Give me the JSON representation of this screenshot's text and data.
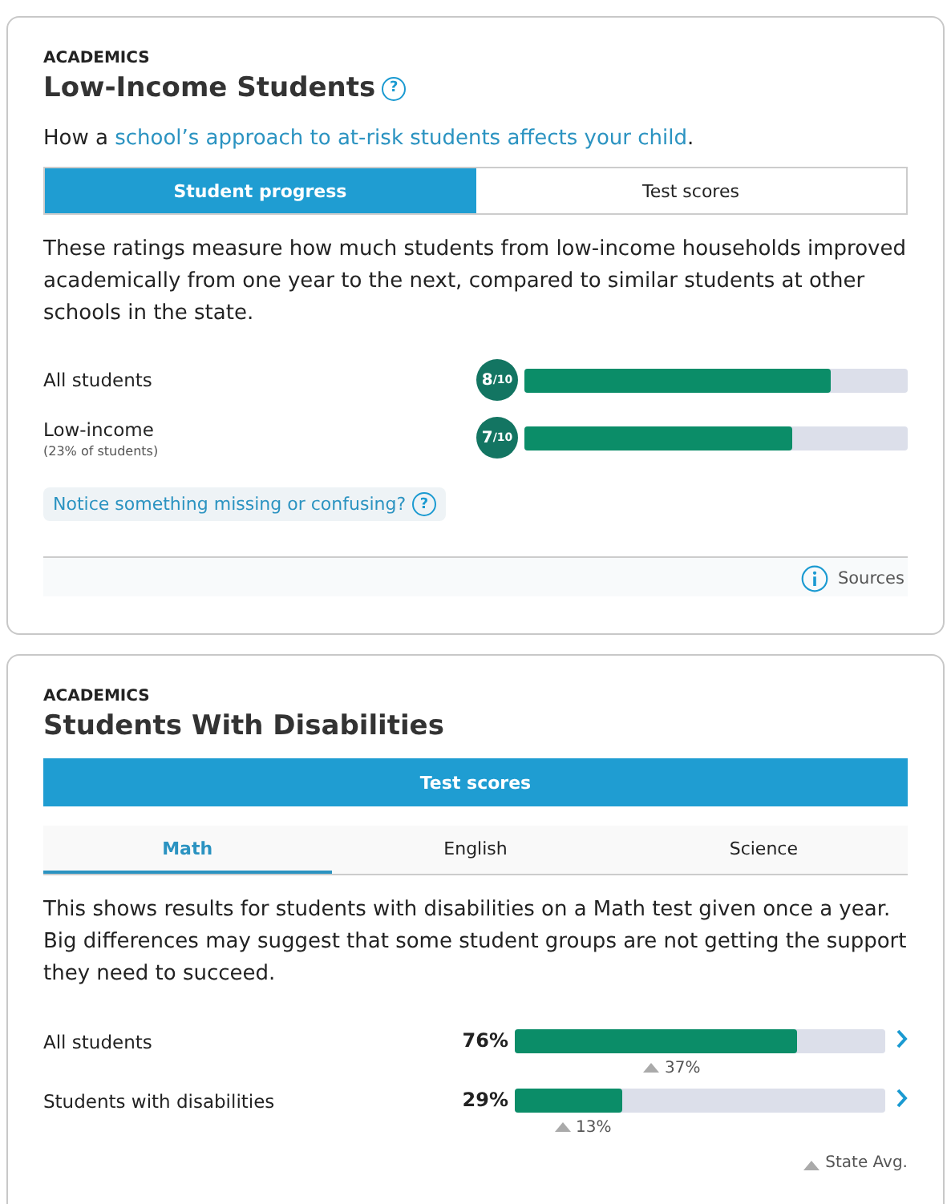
{
  "low_income": {
    "eyebrow": "ACADEMICS",
    "title": "Low-Income Students",
    "help_icon": "?",
    "intro": "How a ",
    "intro_link": "school’s approach to at-risk students affects your child",
    "intro_end": ".",
    "tabs": [
      {
        "label": "Student progress",
        "selected": true
      },
      {
        "label": "Test scores",
        "selected": false
      }
    ],
    "description": "These ratings measure how much students from low-income households improved academically from one year to the next, compared to similar students at other schools in the state.",
    "rows": [
      {
        "label": "All students",
        "score": "8",
        "out_of": "/10",
        "level": 0.8
      },
      {
        "label": "Low-income",
        "note": "(23% of students)",
        "score": "7",
        "out_of": "/10",
        "level": 0.7
      }
    ],
    "notice": "Notice something missing or confusing?",
    "notice_icon": "?",
    "sources": "Sources"
  },
  "disabilities": {
    "eyebrow": "ACADEMICS",
    "title": "Students With Disabilities",
    "tabs": [
      {
        "label": "Test scores",
        "selected": true
      }
    ],
    "subject_tabs": [
      {
        "label": "Math",
        "selected": true
      },
      {
        "label": "English",
        "selected": false
      },
      {
        "label": "Science",
        "selected": false
      }
    ],
    "description": "This shows results for students with disabilities on a Math test given once a year. Big differences may suggest that some student groups are not getting the support they need to succeed.",
    "rows": [
      {
        "label": "All students",
        "value": "76%",
        "level": 0.76,
        "state_avg": {
          "label": "37%",
          "level": 0.37
        }
      },
      {
        "label": "Students with disabilities",
        "value": "29%",
        "level": 0.29,
        "state_avg": {
          "label": "13%",
          "level": 0.13
        }
      }
    ],
    "legend": "State Avg."
  }
}
